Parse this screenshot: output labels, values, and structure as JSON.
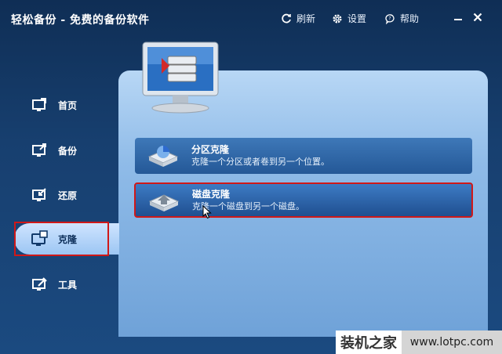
{
  "app": {
    "title": "轻松备份 - 免费的备份软件"
  },
  "toolbar": {
    "refresh_label": "刷新",
    "settings_label": "设置",
    "help_label": "帮助"
  },
  "sidebar": {
    "items": [
      {
        "label": "首页",
        "icon": "home-icon"
      },
      {
        "label": "备份",
        "icon": "backup-icon"
      },
      {
        "label": "还原",
        "icon": "restore-icon"
      },
      {
        "label": "克隆",
        "icon": "clone-icon",
        "active": true
      },
      {
        "label": "工具",
        "icon": "tools-icon"
      }
    ]
  },
  "main": {
    "cards": [
      {
        "title": "分区克隆",
        "description": "克隆一个分区或者卷到另一个位置。",
        "icon": "partition-clone-icon"
      },
      {
        "title": "磁盘克隆",
        "description": "克隆一个磁盘到另一个磁盘。",
        "icon": "disk-clone-icon",
        "highlighted": true
      }
    ]
  },
  "watermark": {
    "left": "装机之家",
    "right": "www.lotpc.com"
  },
  "colors": {
    "background": "#173f6f",
    "panel": "#8fbbe8",
    "highlight_border": "#d01818"
  }
}
